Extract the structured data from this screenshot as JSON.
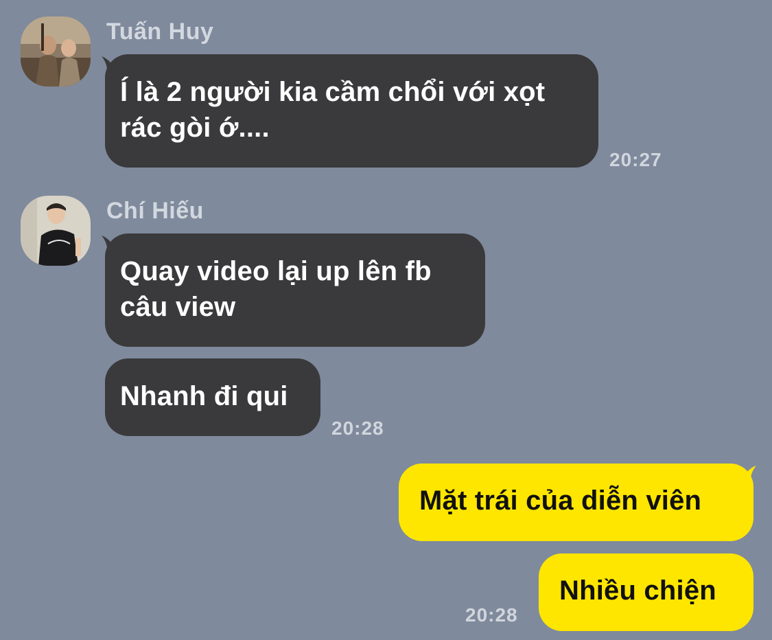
{
  "chat": {
    "groups": [
      {
        "sender": "Tuấn Huy",
        "messages": [
          "Í là 2 người kia cầm chổi với xọt rác gòi ớ...."
        ],
        "time": "20:27"
      },
      {
        "sender": "Chí Hiếu",
        "messages": [
          "Quay video lại up lên fb câu view",
          "Nhanh đi qui"
        ],
        "time": "20:28"
      },
      {
        "sender": "",
        "messages": [
          "Mặt trái của diễn viên",
          "Nhiều chiện"
        ],
        "time": "20:28"
      }
    ]
  },
  "colors": {
    "background": "#7f8a9c",
    "incoming_bubble": "#3a3a3c",
    "outgoing_bubble": "#ffe600",
    "sender_name": "#d3d8e0",
    "timestamp": "#d1d6de"
  },
  "icons": {
    "avatar_1": "user-avatar-photo",
    "avatar_2": "user-avatar-photo"
  }
}
